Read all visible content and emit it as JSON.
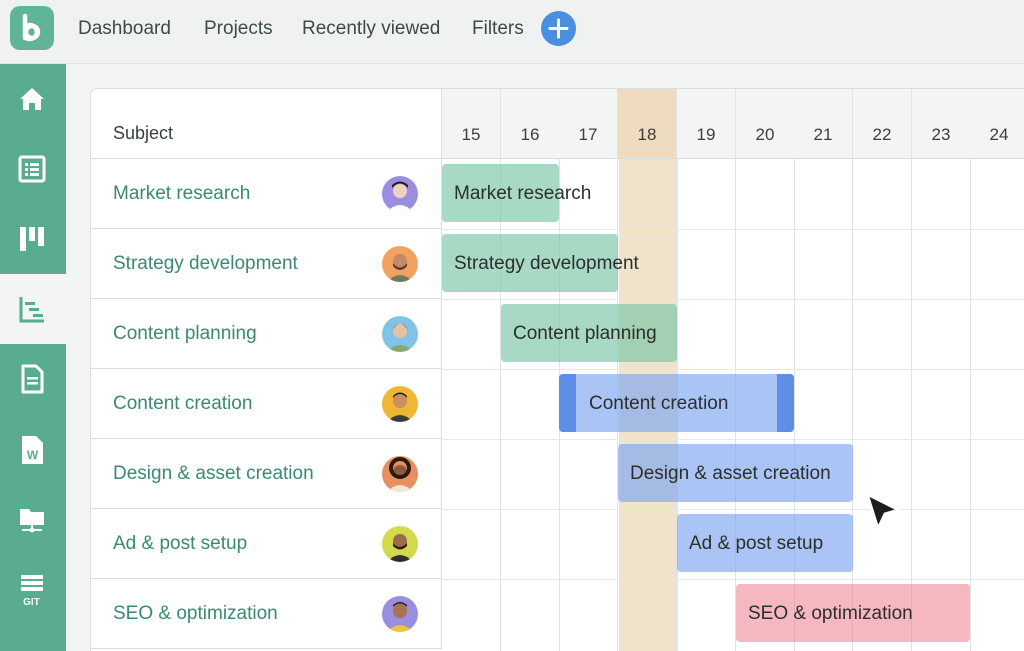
{
  "header": {
    "logo_glyph": "b",
    "nav": [
      "Dashboard",
      "Projects",
      "Recently viewed",
      "Filters"
    ],
    "add_icon": "plus-icon"
  },
  "sidebar": {
    "items": [
      {
        "icon": "home-icon",
        "active": false
      },
      {
        "icon": "list-icon",
        "active": false
      },
      {
        "icon": "board-icon",
        "active": false
      },
      {
        "icon": "gantt-icon",
        "active": true
      },
      {
        "icon": "document-icon",
        "active": false
      },
      {
        "icon": "word-file-icon",
        "active": false,
        "glyph": "W"
      },
      {
        "icon": "folder-network-icon",
        "active": false
      },
      {
        "icon": "git-icon",
        "active": false,
        "glyph": "GIT"
      }
    ]
  },
  "table": {
    "subject_header": "Subject",
    "days": [
      "15",
      "16",
      "17",
      "18",
      "19",
      "20",
      "21",
      "22",
      "23",
      "24"
    ],
    "today": "18",
    "rows": [
      {
        "subject": "Market research",
        "start": "15",
        "end": "16",
        "color": "green"
      },
      {
        "subject": "Strategy development",
        "start": "15",
        "end": "17",
        "color": "green"
      },
      {
        "subject": "Content planning",
        "start": "16",
        "end": "18",
        "color": "green"
      },
      {
        "subject": "Content creation",
        "start": "17",
        "end": "20",
        "color": "blue",
        "selected": true
      },
      {
        "subject": "Design & asset creation",
        "start": "18",
        "end": "21",
        "color": "blue"
      },
      {
        "subject": "Ad & post setup",
        "start": "19",
        "end": "21",
        "color": "blue"
      },
      {
        "subject": "SEO & optimization",
        "start": "20",
        "end": "23",
        "color": "pink"
      }
    ]
  },
  "colors": {
    "accent": "#5aac8e",
    "subject_text": "#3a8a6e",
    "today_highlight": "#e4cba0",
    "bar_green": "#7ac4a6",
    "bar_blue": "#7da6f0",
    "bar_pink": "#ee8996"
  }
}
